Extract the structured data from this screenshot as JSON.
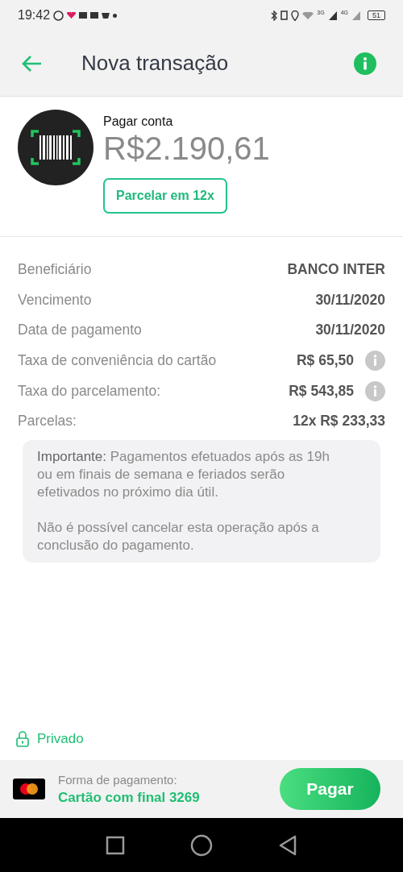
{
  "status_bar": {
    "time": "19:42",
    "network_3g": "3G",
    "network_4g": "4G",
    "battery": "51"
  },
  "app_bar": {
    "title": "Nova transação"
  },
  "header": {
    "label": "Pagar conta",
    "amount": "R$2.190,61",
    "installment_button": "Parcelar em 12x"
  },
  "details": [
    {
      "label": "Beneficiário",
      "value": "BANCO INTER",
      "info": false
    },
    {
      "label": "Vencimento",
      "value": "30/11/2020",
      "info": false
    },
    {
      "label": "Data de pagamento",
      "value": "30/11/2020",
      "info": false
    },
    {
      "label": "Taxa de conveniência do cartão",
      "value": "R$ 65,50",
      "info": true
    },
    {
      "label": "Taxa do parcelamento:",
      "value": "R$ 543,85",
      "info": true
    },
    {
      "label": "Parcelas:",
      "value": "12x R$ 233,33",
      "info": false
    }
  ],
  "notice": [
    "**Importante:** Pagamentos efetuados após as 19h ou em finais de semana e feriados serão efetivados no próximo dia útil.",
    "Não é possível cancelar esta operação após a conclusão do pagamento."
  ],
  "privacy": {
    "label": "Privado"
  },
  "payment": {
    "caption": "Forma de pagamento:",
    "method": "Cartão com final 3269",
    "button": "Pagar"
  }
}
